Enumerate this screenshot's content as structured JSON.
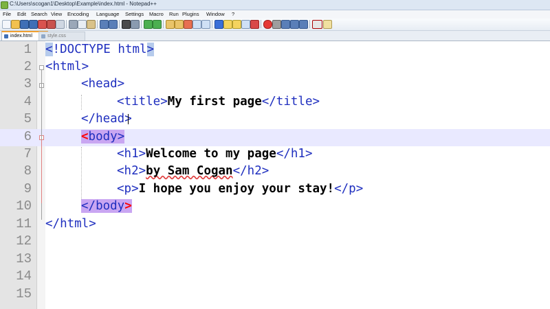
{
  "window": {
    "title": "C:\\Users\\scogan1\\Desktop\\Example\\index.html - Notepad++"
  },
  "menu": [
    "File",
    "Edit",
    "Search",
    "View",
    "Encoding",
    "Language",
    "Settings",
    "Macro",
    "Run",
    "Plugins",
    "Window",
    "?"
  ],
  "tabs": [
    {
      "label": "index.html",
      "active": true
    },
    {
      "label": "style.css",
      "active": false
    }
  ],
  "editor": {
    "line_numbers": [
      "1",
      "2",
      "3",
      "4",
      "5",
      "6",
      "7",
      "8",
      "9",
      "10",
      "11",
      "12",
      "13",
      "14",
      "15"
    ],
    "current_line": 6,
    "lines": {
      "l1": {
        "open": "<",
        "doctype": "!DOCTYPE html",
        "close": ">"
      },
      "l2": {
        "tag": "<html>"
      },
      "l3": {
        "tag": "<head>"
      },
      "l4": {
        "open": "<title>",
        "text": "My first page",
        "close": "</title>"
      },
      "l5": {
        "tag": "</head>"
      },
      "l6": {
        "lt": "<",
        "name": "body",
        "gt": ">"
      },
      "l7": {
        "open": "<h1>",
        "text": "Welcome to my page",
        "close": "</h1>"
      },
      "l8": {
        "open": "<h2>",
        "text": "by Sam Cogan",
        "close": "</h2>"
      },
      "l9": {
        "open": "<p>",
        "text": "I hope you enjoy your stay!",
        "close": "</p>"
      },
      "l10": {
        "lt": "</",
        "name": "body",
        "gt": ">"
      },
      "l11": {
        "tag": "</html>"
      }
    }
  },
  "colors": {
    "tag": "#1f2fbf",
    "brace_match": "#ff0000",
    "current_line": "#e9e9ff",
    "doctype_highlight": "#b6cbec",
    "body_highlight": "#c9a6f2"
  }
}
